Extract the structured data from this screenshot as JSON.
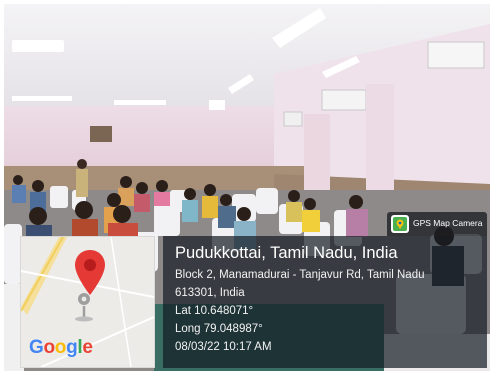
{
  "badge": {
    "icon": "gps-map-camera-icon",
    "label": "GPS Map Camera"
  },
  "map": {
    "logo_text": "Google",
    "pin_color": "#e53935"
  },
  "location": {
    "place": "Pudukkottai, Tamil Nadu, India",
    "address_line1": "Block 2, Manamadurai - Tanjavur Rd, Tamil Nadu",
    "address_line2": "613301, India",
    "latitude": "Lat 10.648071°",
    "longitude": "Long 79.048987°",
    "datetime": "08/03/22 10:17 AM"
  },
  "colors": {
    "panel_bg": "rgba(18,26,34,0.70)",
    "google_blue": "#4285F4",
    "google_red": "#EA4335",
    "google_yellow": "#FBBC05",
    "google_green": "#34A853"
  }
}
